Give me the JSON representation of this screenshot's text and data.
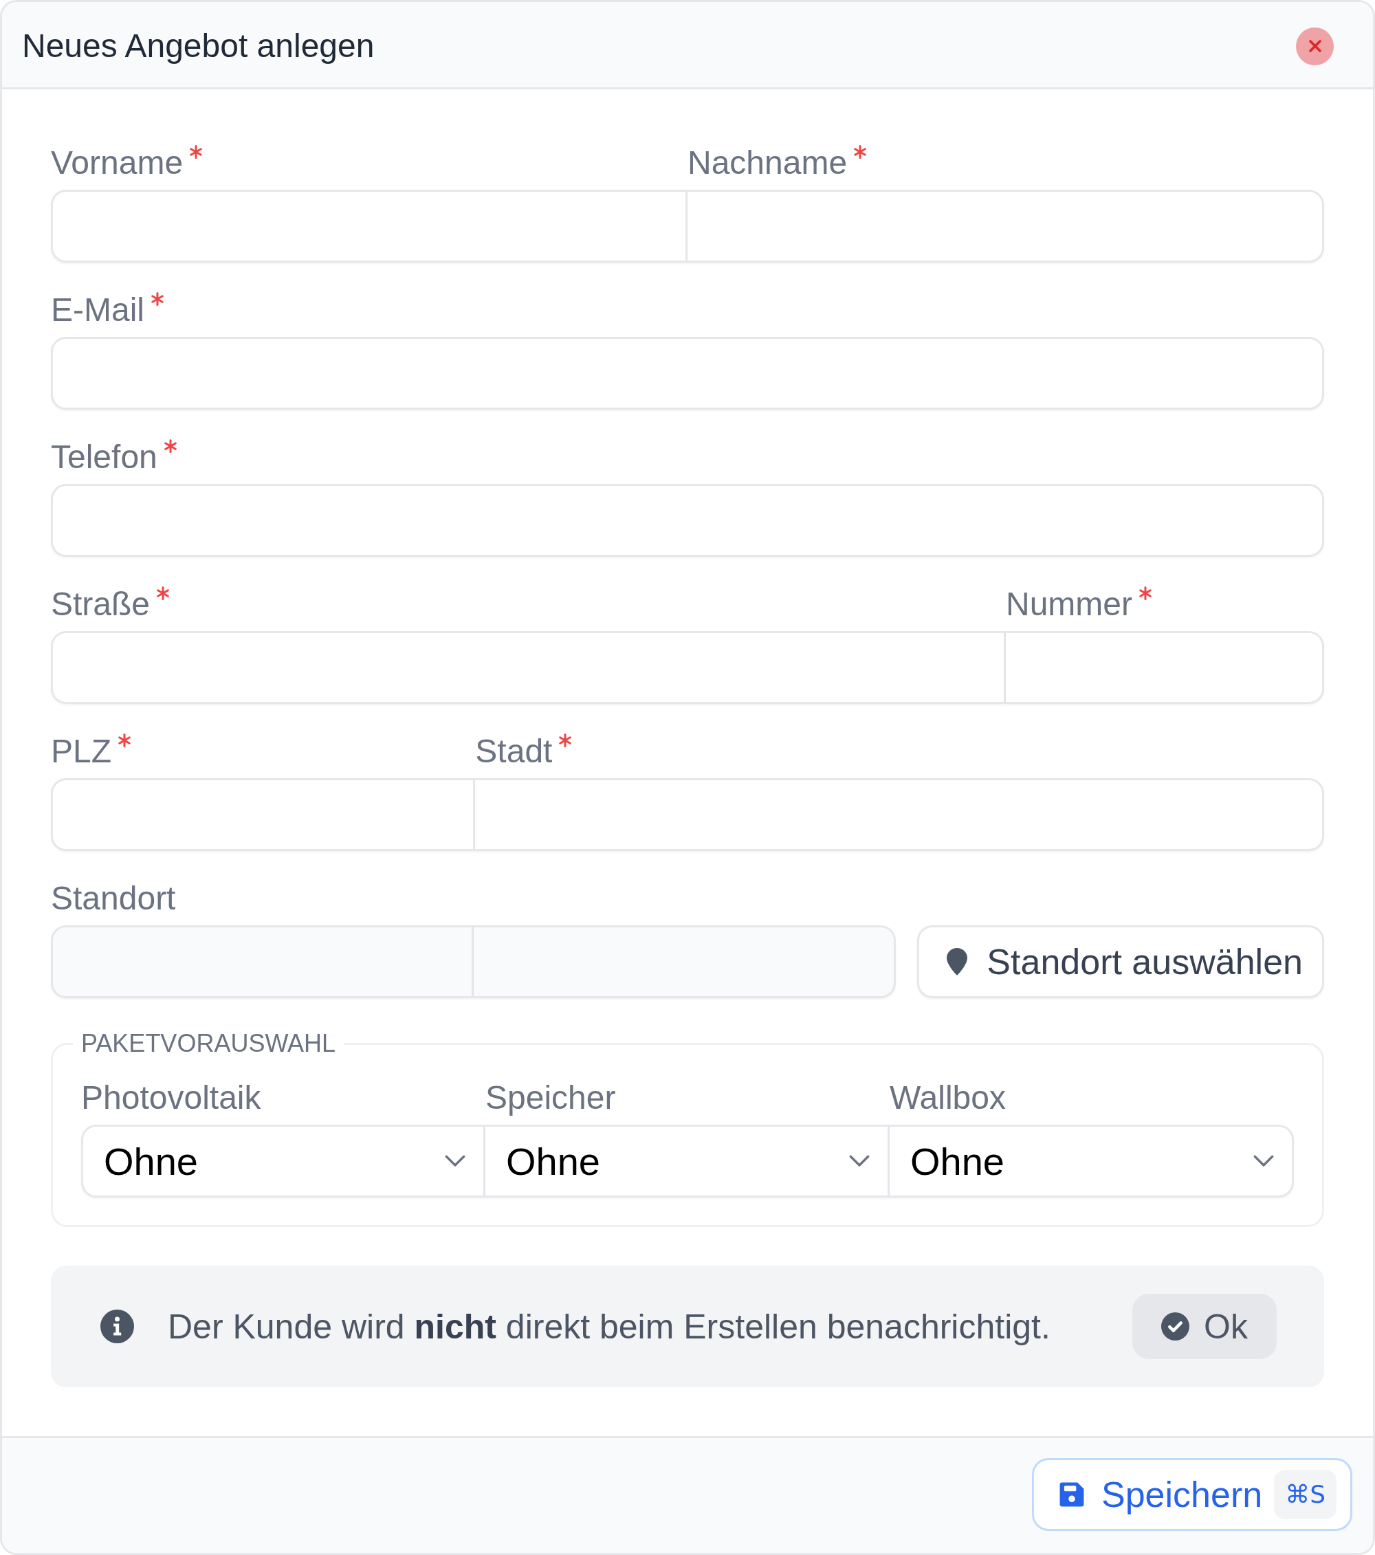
{
  "dialog": {
    "title": "Neues Angebot anlegen"
  },
  "form": {
    "rows": [
      {
        "fields": [
          {
            "label": "Vorname",
            "required": true
          },
          {
            "label": "Nachname",
            "required": true
          }
        ]
      },
      {
        "fields": [
          {
            "label": "E-Mail",
            "required": true
          }
        ]
      },
      {
        "fields": [
          {
            "label": "Telefon",
            "required": true
          }
        ]
      },
      {
        "fields": [
          {
            "label": "Straße",
            "required": true
          },
          {
            "label": "Nummer",
            "required": true
          }
        ]
      },
      {
        "fields": [
          {
            "label": "PLZ",
            "required": true
          },
          {
            "label": "Stadt",
            "required": true
          }
        ]
      }
    ],
    "location": {
      "label": "Standort",
      "button": "Standort auswählen"
    }
  },
  "package_preselection": {
    "legend": "PAKETVORAUSWAHL",
    "selects": [
      {
        "label": "Photovoltaik",
        "value": "Ohne"
      },
      {
        "label": "Speicher",
        "value": "Ohne"
      },
      {
        "label": "Wallbox",
        "value": "Ohne"
      }
    ]
  },
  "notice": {
    "text": "Der Kunde wird **nicht** direkt beim Erstellen benachrichtigt.",
    "button": "Ok"
  },
  "footer": {
    "save_button": {
      "label": "Speichern",
      "shortcut": "⌘S"
    }
  }
}
